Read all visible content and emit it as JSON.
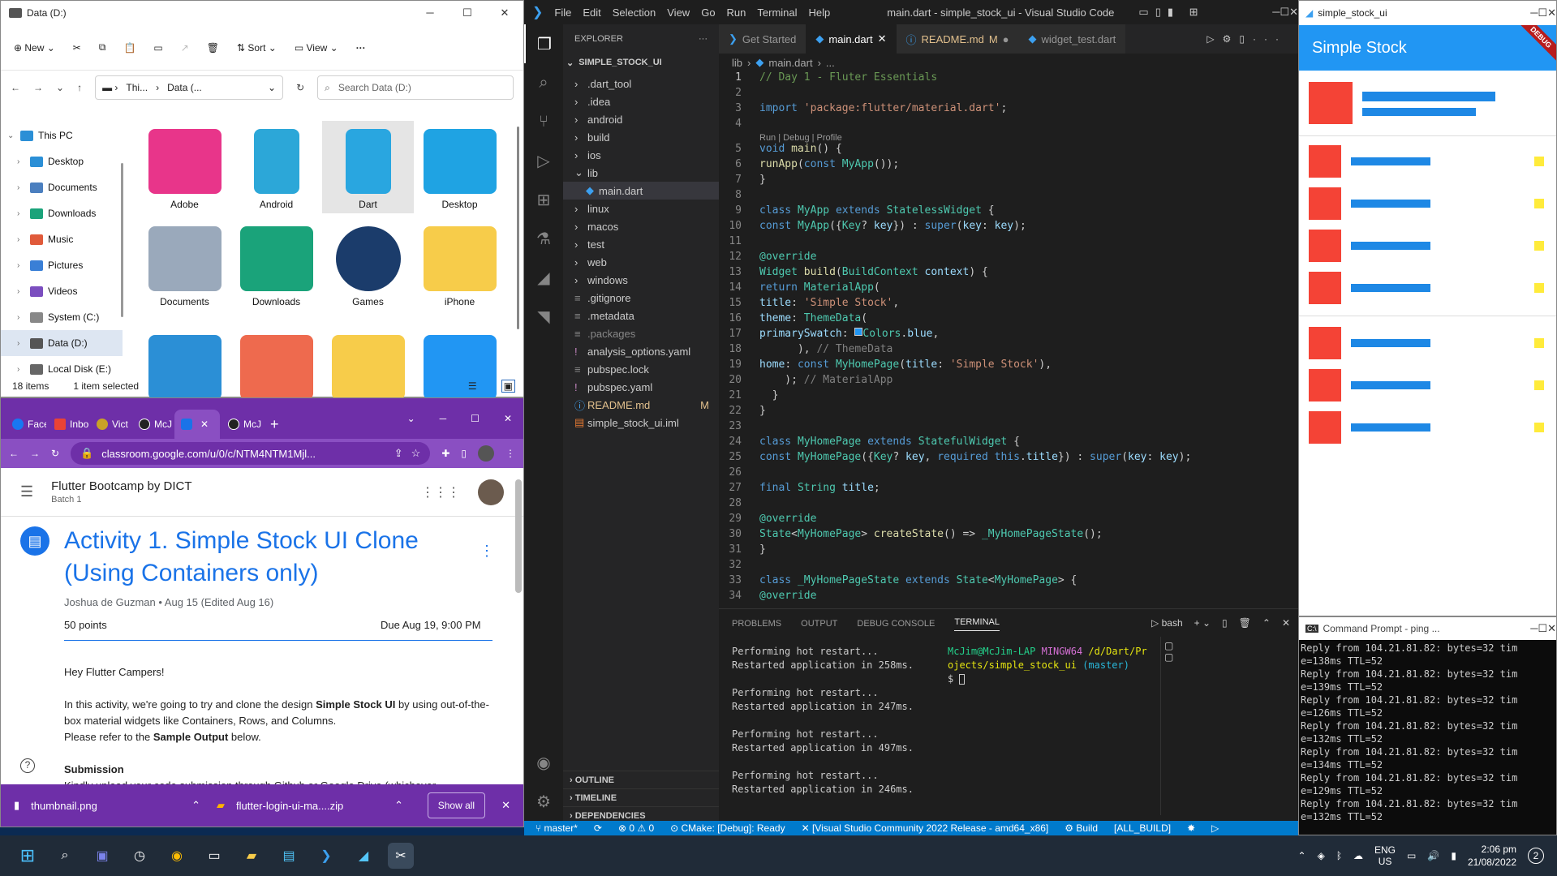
{
  "explorer": {
    "title": "Data (D:)",
    "commands": {
      "new": "New",
      "sort": "Sort",
      "view": "View"
    },
    "breadcrumb": [
      "Thi...",
      "Data (..."
    ],
    "search_placeholder": "Search Data (D:)",
    "nav": [
      {
        "label": "This PC",
        "icon": "this-pc-icon"
      },
      {
        "label": "Desktop",
        "icon": "desktop-icon"
      },
      {
        "label": "Documents",
        "icon": "documents-icon"
      },
      {
        "label": "Downloads",
        "icon": "downloads-icon"
      },
      {
        "label": "Music",
        "icon": "music-icon"
      },
      {
        "label": "Pictures",
        "icon": "pictures-icon"
      },
      {
        "label": "Videos",
        "icon": "videos-icon"
      },
      {
        "label": "System (C:)",
        "icon": "drive-icon"
      },
      {
        "label": "Data (D:)",
        "icon": "drive-icon"
      },
      {
        "label": "Local Disk (E:)",
        "icon": "drive-icon"
      }
    ],
    "items": [
      {
        "label": "Adobe",
        "icon": "adobe-cc-icon",
        "color": "#e8358a"
      },
      {
        "label": "Android",
        "icon": "android-folder-icon",
        "color": "#2ca7d8"
      },
      {
        "label": "Dart",
        "icon": "dart-folder-icon",
        "color": "#29a6e0"
      },
      {
        "label": "Desktop",
        "icon": "desktop-folder-icon",
        "color": "#1fa3e3"
      },
      {
        "label": "Documents",
        "icon": "documents-folder-icon",
        "color": "#9aa9bb"
      },
      {
        "label": "Downloads",
        "icon": "downloads-folder-icon",
        "color": "#1aa37a"
      },
      {
        "label": "Games",
        "icon": "steam-icon",
        "color": "#1b3c6b"
      },
      {
        "label": "iPhone",
        "icon": "folder-icon",
        "color": "#f7cc4a"
      },
      {
        "label": "",
        "icon": "pc-folder-icon",
        "color": "#2b8fd6"
      },
      {
        "label": "",
        "icon": "music-folder-icon",
        "color": "#ee6a4e"
      },
      {
        "label": "",
        "icon": "folder-icon",
        "color": "#f7cc4a"
      },
      {
        "label": "",
        "icon": "pictures-folder-icon",
        "color": "#2196f3"
      }
    ],
    "status": {
      "count": "18 items",
      "selected": "1 item selected"
    }
  },
  "chrome": {
    "tabs": [
      "Face",
      "Inbo",
      "Vict",
      "McJ",
      "",
      "McJ"
    ],
    "url": "classroom.google.com/u/0/c/NTM4NTM1Mjl...",
    "course_title": "Flutter Bootcamp by DICT",
    "course_sub": "Batch 1",
    "activity_title": "Activity 1. Simple Stock UI Clone (Using Containers only)",
    "meta": "Joshua de Guzman • Aug 15 (Edited Aug 16)",
    "points": "50 points",
    "due": "Due Aug 19, 9:00 PM",
    "greeting": "Hey Flutter Campers!",
    "body_1": "In this activity, we're going to try and clone the design ",
    "body_bold_1": "Simple Stock UI",
    "body_2": " by using out-of-the-box material widgets like Containers, Rows, and Columns.",
    "body_3": "Please refer to the ",
    "body_bold_2": "Sample Output",
    "body_4": " below.",
    "submission_heading": "Submission",
    "submission_text": "Kindly upload your code submission through Github or Google Drive (whichever",
    "downloads": [
      {
        "name": "thumbnail.png",
        "icon": "image-file-icon"
      },
      {
        "name": "flutter-login-ui-ma....zip",
        "icon": "zip-file-icon"
      }
    ],
    "show_all": "Show all"
  },
  "vscode": {
    "menu": [
      "File",
      "Edit",
      "Selection",
      "View",
      "Go",
      "Run",
      "Terminal",
      "Help"
    ],
    "title": "main.dart - simple_stock_ui - Visual Studio Code",
    "explorer_label": "EXPLORER",
    "project": "SIMPLE_STOCK_UI",
    "tree": [
      {
        "label": ".dart_tool",
        "type": "folder",
        "indent": 1
      },
      {
        "label": ".idea",
        "type": "folder",
        "indent": 1
      },
      {
        "label": "android",
        "type": "folder",
        "indent": 1
      },
      {
        "label": "build",
        "type": "folder",
        "indent": 1
      },
      {
        "label": "ios",
        "type": "folder",
        "indent": 1
      },
      {
        "label": "lib",
        "type": "open",
        "indent": 1
      },
      {
        "label": "main.dart",
        "type": "dart",
        "indent": 2,
        "selected": true
      },
      {
        "label": "linux",
        "type": "folder",
        "indent": 1
      },
      {
        "label": "macos",
        "type": "folder",
        "indent": 1
      },
      {
        "label": "test",
        "type": "folder",
        "indent": 1
      },
      {
        "label": "web",
        "type": "folder",
        "indent": 1
      },
      {
        "label": "windows",
        "type": "folder",
        "indent": 1
      },
      {
        "label": ".gitignore",
        "type": "file",
        "indent": 1
      },
      {
        "label": ".metadata",
        "type": "file",
        "indent": 1
      },
      {
        "label": ".packages",
        "type": "file",
        "indent": 1
      },
      {
        "label": "analysis_options.yaml",
        "type": "yaml",
        "indent": 1
      },
      {
        "label": "pubspec.lock",
        "type": "file",
        "indent": 1
      },
      {
        "label": "pubspec.yaml",
        "type": "yaml",
        "indent": 1
      },
      {
        "label": "README.md",
        "type": "md",
        "indent": 1,
        "badge": "M"
      },
      {
        "label": "simple_stock_ui.iml",
        "type": "iml",
        "indent": 1
      }
    ],
    "outline": "OUTLINE",
    "timeline": "TIMELINE",
    "dependencies": "DEPENDENCIES",
    "tabs": [
      {
        "label": "Get Started",
        "icon": "vscode-icon"
      },
      {
        "label": "main.dart",
        "icon": "dart-icon",
        "active": true
      },
      {
        "label": "README.md",
        "icon": "info-icon",
        "badge": "M"
      },
      {
        "label": "widget_test.dart",
        "icon": "dart-icon"
      }
    ],
    "breadcrumb": [
      "lib",
      "main.dart",
      "..."
    ],
    "code_hint": "Run | Debug | Profile",
    "panel_tabs": [
      "PROBLEMS",
      "OUTPUT",
      "DEBUG CONSOLE",
      "TERMINAL"
    ],
    "terminal_lines": [
      "Performing hot restart...",
      "Restarted application in 258ms.",
      "",
      "Performing hot restart...",
      "Restarted application in 247ms.",
      "",
      "Performing hot restart...",
      "Restarted application in 497ms.",
      "",
      "Performing hot restart...",
      "Restarted application in 246ms."
    ],
    "bash_prompt_user": "McJim@McJim-LAP",
    "bash_prompt_sys": "MINGW64",
    "bash_prompt_path": "/d/Dart/Projects/simple_stock_ui",
    "bash_branch": "(master)",
    "bash_label": "bash",
    "status": [
      "master*",
      "⊗ 0 ⚠ 0",
      "CMake: [Debug]: Ready",
      "[Visual Studio Community 2022 Release - amd64_x86]",
      "Build",
      "[ALL_BUILD]"
    ]
  },
  "flutter": {
    "window_title": "simple_stock_ui",
    "app_title": "Simple Stock",
    "debug": "DEBUG",
    "colors": {
      "red": "#f44336",
      "blue": "#1e88e5",
      "yellow": "#ffeb3b"
    }
  },
  "cmd": {
    "title": "Command Prompt - ping ...",
    "lines": [
      "Reply from 104.21.81.82: bytes=32 tim",
      "e=138ms TTL=52",
      "Reply from 104.21.81.82: bytes=32 tim",
      "e=139ms TTL=52",
      "Reply from 104.21.81.82: bytes=32 tim",
      "e=126ms TTL=52",
      "Reply from 104.21.81.82: bytes=32 tim",
      "e=132ms TTL=52",
      "Reply from 104.21.81.82: bytes=32 tim",
      "e=134ms TTL=52",
      "Reply from 104.21.81.82: bytes=32 tim",
      "e=129ms TTL=52",
      "Reply from 104.21.81.82: bytes=32 tim",
      "e=132ms TTL=52"
    ]
  },
  "taskbar": {
    "lang": "ENG",
    "region": "US",
    "time": "2:06 pm",
    "date": "21/08/2022",
    "notif": "2"
  }
}
